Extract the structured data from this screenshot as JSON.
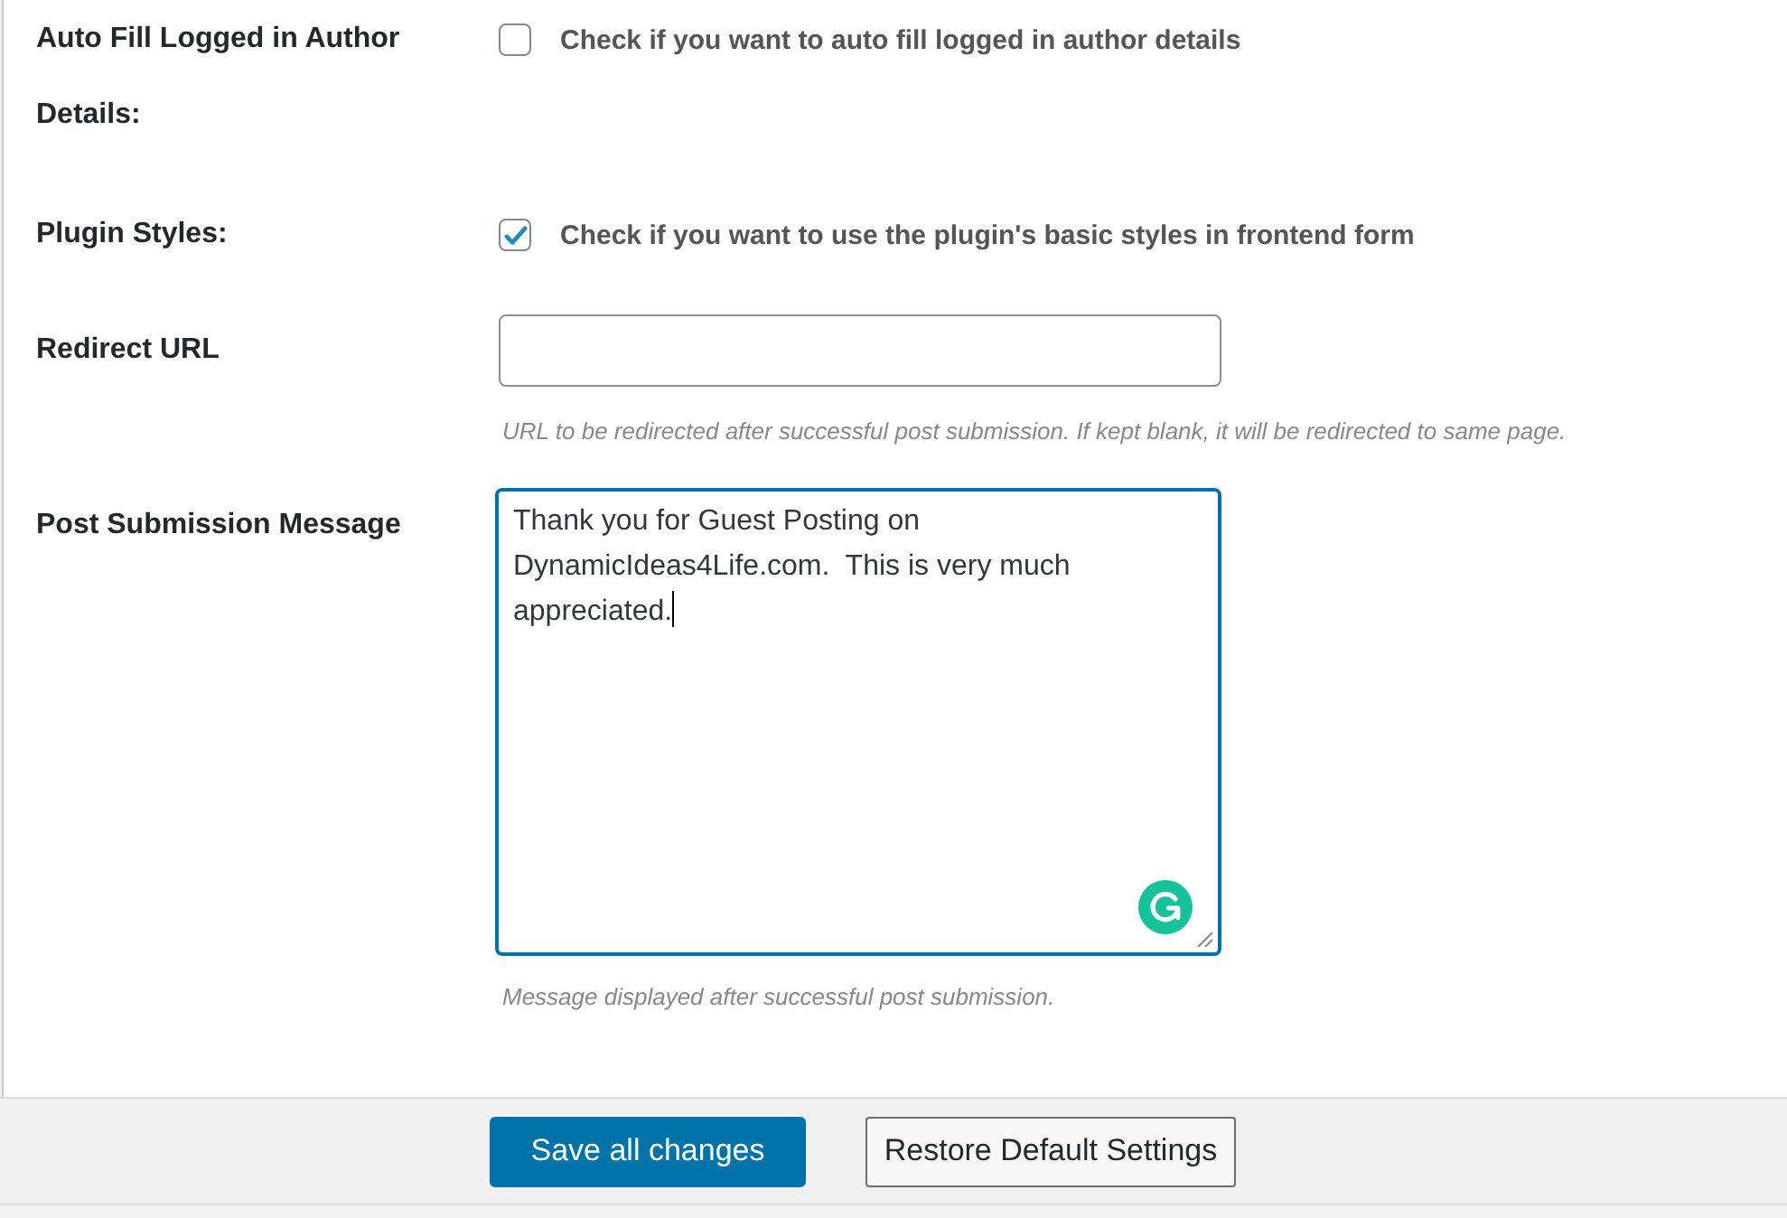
{
  "settings": [
    {
      "kind": "checkbox",
      "label": "Auto Fill Logged in Author Details:",
      "checked": false,
      "description": "Check if you want to auto fill logged in author details"
    },
    {
      "kind": "checkbox",
      "label": "Plugin Styles:",
      "checked": true,
      "description": "Check if you want to use the plugin's basic styles in frontend form"
    },
    {
      "kind": "text",
      "label": "Redirect URL",
      "help": "URL to be redirected after successful post submission. If kept blank, it will be redirected to same page."
    },
    {
      "kind": "textarea",
      "label": "Post Submission Message",
      "focused": true,
      "value": "Thank you for Guest Posting on DynamicIdeas4Life.com.  This is very much appreciated.",
      "help": "Message displayed after successful post submission."
    }
  ],
  "buttons": [
    {
      "kind": "primary",
      "label": "Save all changes"
    },
    {
      "kind": "secondary",
      "label": "Restore Default Settings"
    }
  ]
}
